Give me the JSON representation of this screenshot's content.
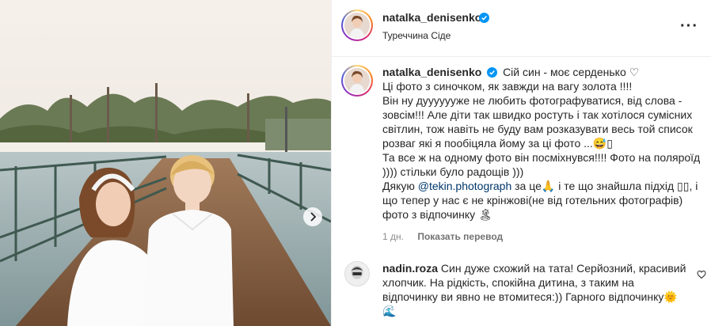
{
  "post": {
    "author": "natalka_denisenko",
    "location": "Туреччина Сіде"
  },
  "caption": {
    "username": "natalka_denisenko",
    "lines": [
      "Сій син - моє серденько ♡",
      "Ці фото з синочком, як завжди на вагу золота !!!!",
      "Він ну дууууууже не любить фотографуватися, від слова -",
      "зовсім!!! Але діти так швидко ростуть і так хотілося сумісних",
      "світлин, тож навіть не буду вам розказувати весь той список",
      "розваг які я пообіцяла йому за ці фото ...😅▯",
      "Та все ж на одному фото він посміхнувся!!!! Фото на поляроїд",
      ")))) стільки було радощів )))"
    ],
    "thanks_prefix": "Дякую ",
    "mention": "@tekin.photograph",
    "thanks_rest": " за це🙏 і те що знайшла підхід ▯▯, і",
    "lines_after": [
      "що тепер у нас є не крінжові(не від готельних фотографів)",
      "фото з відпочинку 🏝"
    ]
  },
  "meta": {
    "time": "1 дн.",
    "translate": "Показать перевод"
  },
  "comment": {
    "username": "nadin.roza",
    "lines": [
      "Син дуже схожий на тата! Серйозний, красивий",
      "хлопчик. На рідкість, спокійна дитина, з таким на",
      "відпочинку ви явно не втомитеся:)) Гарного відпочинку🌞",
      "🌊"
    ]
  },
  "icons": {
    "verified": "verified-badge-icon",
    "more": "more-options-icon",
    "heart": "heart-icon",
    "next": "chevron-right-icon"
  },
  "colors": {
    "verified": "#0095f6",
    "mention": "#00376b",
    "secondary": "#8e8e8e"
  }
}
